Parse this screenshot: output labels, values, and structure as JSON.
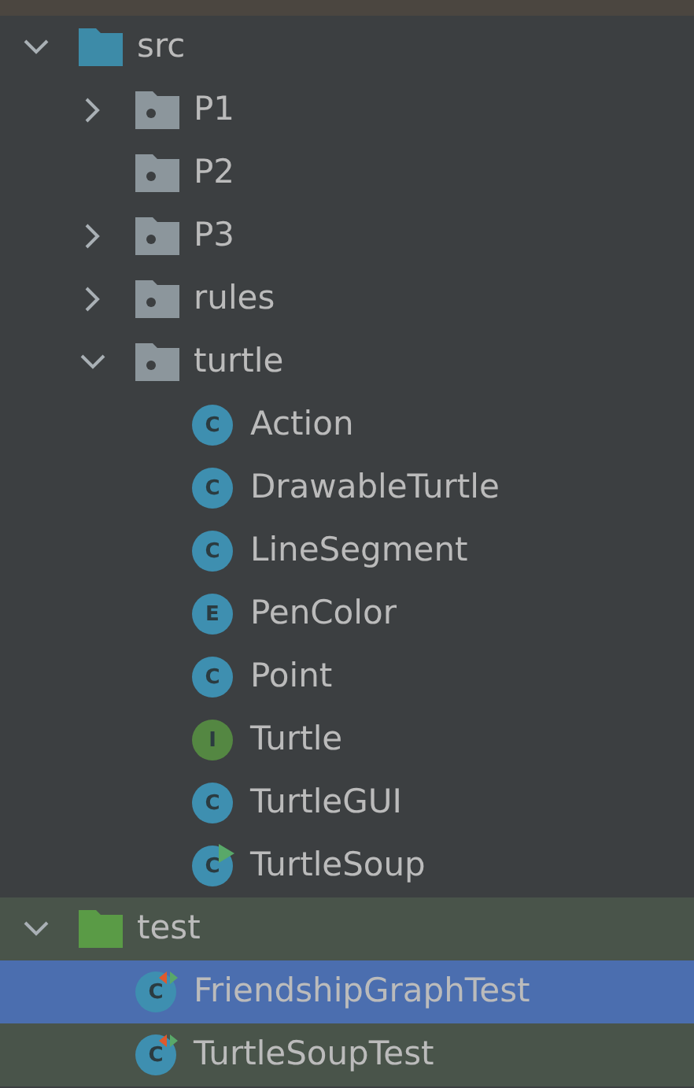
{
  "tree": [
    {
      "name": "src",
      "kind": "source-root",
      "expanded": true,
      "selected": false,
      "children": [
        {
          "name": "P1",
          "kind": "package",
          "expanded": false,
          "selected": false
        },
        {
          "name": "P2",
          "kind": "package",
          "selected": false
        },
        {
          "name": "P3",
          "kind": "package",
          "expanded": false,
          "selected": false
        },
        {
          "name": "rules",
          "kind": "package",
          "expanded": false,
          "selected": false
        },
        {
          "name": "turtle",
          "kind": "package",
          "expanded": true,
          "selected": false,
          "children": [
            {
              "name": "Action",
              "kind": "class",
              "icon_letter": "C",
              "selected": false
            },
            {
              "name": "DrawableTurtle",
              "kind": "class",
              "icon_letter": "C",
              "selected": false
            },
            {
              "name": "LineSegment",
              "kind": "class",
              "icon_letter": "C",
              "selected": false
            },
            {
              "name": "PenColor",
              "kind": "enum",
              "icon_letter": "E",
              "selected": false
            },
            {
              "name": "Point",
              "kind": "class",
              "icon_letter": "C",
              "selected": false
            },
            {
              "name": "Turtle",
              "kind": "interface",
              "icon_letter": "I",
              "selected": false
            },
            {
              "name": "TurtleGUI",
              "kind": "class",
              "icon_letter": "C",
              "selected": false
            },
            {
              "name": "TurtleSoup",
              "kind": "class",
              "icon_letter": "C",
              "runnable": true,
              "selected": false
            }
          ]
        }
      ]
    },
    {
      "name": "test",
      "kind": "test-root",
      "expanded": true,
      "selected": false,
      "children": [
        {
          "name": "FriendshipGraphTest",
          "kind": "class",
          "icon_letter": "C",
          "test": true,
          "selected": true
        },
        {
          "name": "TurtleSoupTest",
          "kind": "class",
          "icon_letter": "C",
          "test": true,
          "selected": false
        }
      ]
    }
  ]
}
